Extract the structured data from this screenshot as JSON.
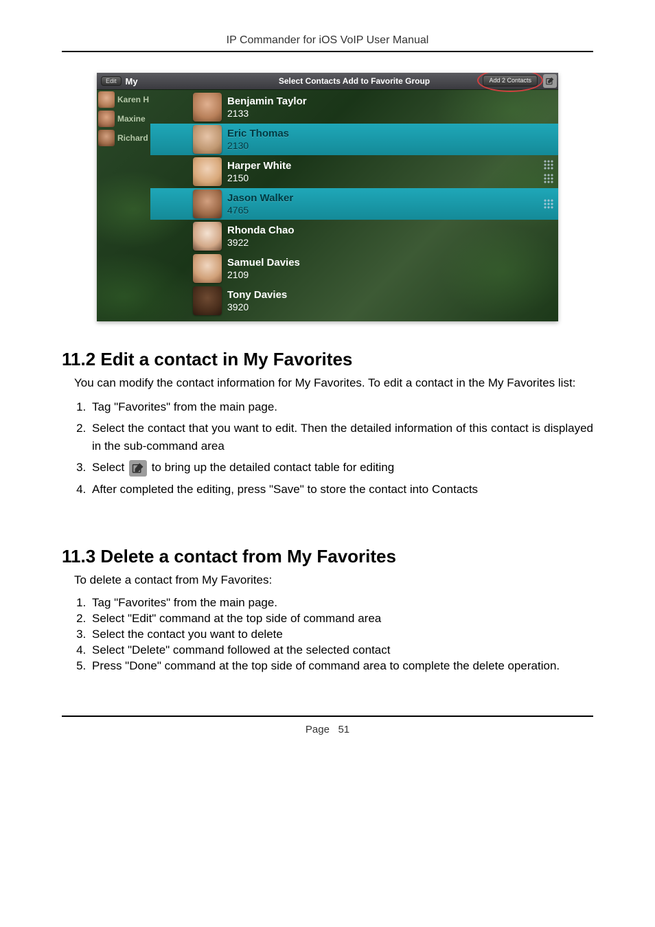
{
  "header": {
    "title": "IP Commander for iOS VoIP User Manual"
  },
  "footer": {
    "page_label": "Page",
    "page_number": "51"
  },
  "screenshot": {
    "sidebar": {
      "edit_label": "Edit",
      "my_label": "My",
      "items": [
        {
          "label": "Karen H"
        },
        {
          "label": "Maxine "
        },
        {
          "label": "Richard"
        }
      ]
    },
    "main": {
      "title": "Select Contacts Add to Favorite Group",
      "add_button": "Add 2 Contacts",
      "contacts": [
        {
          "name": "Benjamin Taylor",
          "number": "2133",
          "selected": false
        },
        {
          "name": "Eric Thomas",
          "number": "2130",
          "selected": true
        },
        {
          "name": "Harper White",
          "number": "2150",
          "selected": false
        },
        {
          "name": "Jason Walker",
          "number": "4765",
          "selected": true
        },
        {
          "name": "Rhonda Chao",
          "number": "3922",
          "selected": false
        },
        {
          "name": "Samuel Davies",
          "number": "2109",
          "selected": false
        },
        {
          "name": "Tony  Davies",
          "number": "3920",
          "selected": false
        }
      ]
    }
  },
  "section1": {
    "heading": "11.2 Edit a contact in My Favorites",
    "intro": "You can modify the contact information for My Favorites.   To edit a contact in the My Favorites list:",
    "steps": {
      "s1": "Tag \"Favorites\" from the main page.",
      "s2": "Select the contact that you want to edit.  Then the detailed information of this contact is displayed in the sub-command area",
      "s3a": "Select ",
      "s3b": " to bring up the detailed contact table for editing",
      "s4": "After completed the editing, press \"Save\" to store the contact into Contacts"
    }
  },
  "section2": {
    "heading": "11.3 Delete a contact from My Favorites",
    "intro": "To delete a contact from My Favorites:",
    "steps": {
      "s1": "Tag \"Favorites\" from the main page.",
      "s2": "Select \"Edit\" command at the top side of command area",
      "s3": "Select the contact you want to delete",
      "s4": "Select \"Delete\" command followed at the selected contact",
      "s5": "Press \"Done\" command at the top side of command area to complete the delete operation."
    }
  }
}
